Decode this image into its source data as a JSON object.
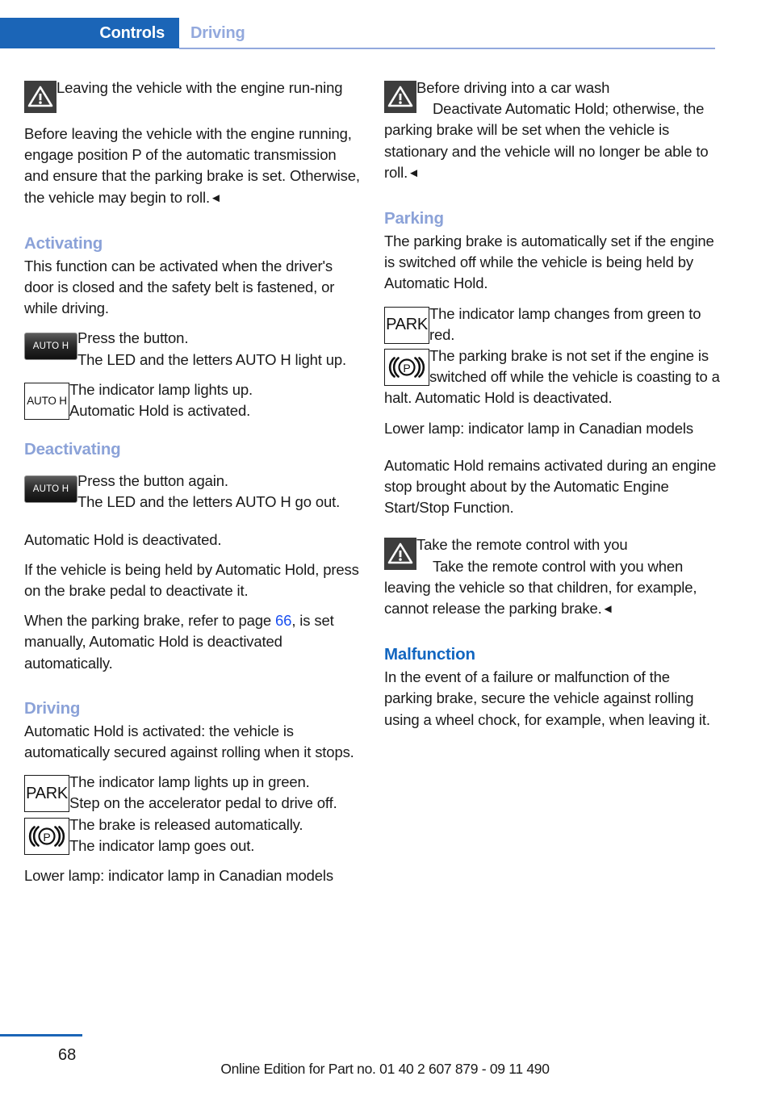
{
  "header": {
    "tab_label": "Controls",
    "section_label": "Driving",
    "tab_color": "#1b65b7",
    "section_color": "#93a9dd"
  },
  "left_column": {
    "warning_1": {
      "icon": "warning-triangle-icon",
      "title": "Leaving the vehicle with the engine run-ning",
      "body": "Before leaving the vehicle with the engine running, engage position P of the automatic transmission and ensure that the parking brake is set. Otherwise, the vehicle may begin to roll.",
      "end_marker": "◄"
    },
    "activating": {
      "heading": "Activating",
      "intro": "This function can be activated when the driver's door is closed and the safety belt is fastened, or while driving.",
      "button_icon_label": "AUTO H",
      "button_step_1": "Press the button.",
      "button_step_2": "The LED and the letters AUTO H light up.",
      "lamp_icon_label": "AUTO H",
      "lamp_line_1": "The indicator lamp lights up.",
      "lamp_line_2": "Automatic Hold is activated."
    },
    "deactivating": {
      "heading": "Deactivating",
      "button_icon_label": "AUTO H",
      "button_step_1": "Press the button again.",
      "button_step_2": "The LED and the letters AUTO H go out.",
      "para_1": "Automatic Hold is deactivated.",
      "para_2": "If the vehicle is being held by Automatic Hold, press on the brake pedal to deactivate it.",
      "para_3_part_1": "When the parking brake, refer to page ",
      "para_3_link": "66",
      "para_3_part_2": ", is set manually, Automatic Hold is deactivated automatically."
    },
    "driving": {
      "heading": "Driving",
      "intro": "Automatic Hold is activated: the vehicle is automatically secured against rolling when it stops.",
      "park_lamp_label": "PARK",
      "park_line_1": "The indicator lamp lights up in green.",
      "park_line_2": "Step on the accelerator pedal to drive off.",
      "pbrake_lamp_label": "(P)",
      "pbrake_line_1": "The brake is released automatically.",
      "pbrake_line_2": "The indicator lamp goes out.",
      "note": "Lower lamp: indicator lamp in Canadian models"
    }
  },
  "right_column": {
    "warning_1": {
      "icon": "warning-triangle-icon",
      "title": "Before driving into a car wash",
      "body": "Deactivate Automatic Hold; otherwise, the parking brake will be set when the vehicle is stationary and the vehicle will no longer be able to roll.",
      "end_marker": "◄"
    },
    "parking": {
      "heading": "Parking",
      "intro": "The parking brake is automatically set if the engine is switched off while the vehicle is being held by Automatic Hold.",
      "park_lamp_label": "PARK",
      "park_line_1": "The indicator lamp changes from green to red.",
      "pbrake_lamp_label": "(P)",
      "pbrake_line_1": "The parking brake is not set if the engine is switched off while the vehicle is coasting to a halt. Automatic Hold is deactivated.",
      "note": "Lower lamp: indicator lamp in Canadian models",
      "para_after": "Automatic Hold remains activated during an engine stop brought about by the Automatic Engine Start/Stop Function."
    },
    "warning_2": {
      "icon": "warning-triangle-icon",
      "title": "Take the remote control with you",
      "body": "Take the remote control with you when leaving the vehicle so that children, for example, cannot release the parking brake.",
      "end_marker": "◄"
    },
    "malfunction": {
      "heading": "Malfunction",
      "body": "In the event of a failure or malfunction of the parking brake, secure the vehicle against rolling using a wheel chock, for example, when leaving it."
    }
  },
  "footer": {
    "page_number": "68",
    "edition_text": "Online Edition for Part no. 01 40 2 607 879 - 09 11 490",
    "rule_color": "#1b65b7"
  }
}
